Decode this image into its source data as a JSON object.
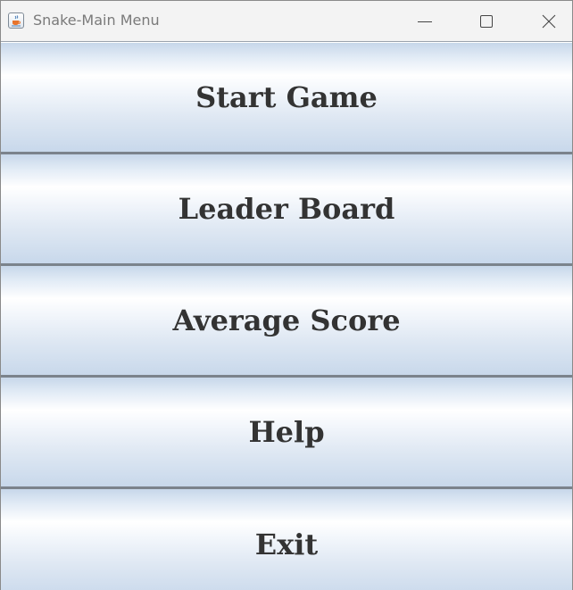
{
  "window": {
    "title": "Snake-Main Menu",
    "icon": "java-cup-icon",
    "controls": [
      "minimize-icon",
      "maximize-icon",
      "close-icon"
    ]
  },
  "menu": {
    "buttons": [
      {
        "label": "Start Game"
      },
      {
        "label": "Leader Board"
      },
      {
        "label": "Average Score"
      },
      {
        "label": "Help"
      },
      {
        "label": "Exit"
      }
    ]
  },
  "colors": {
    "button_text": "#333333",
    "button_gradient_light": "#ffffff",
    "button_gradient_dark": "#c7d7ea",
    "separator": "#7b838c",
    "titlebar_bg": "#f3f3f3",
    "title_text": "#7a7a7a"
  }
}
